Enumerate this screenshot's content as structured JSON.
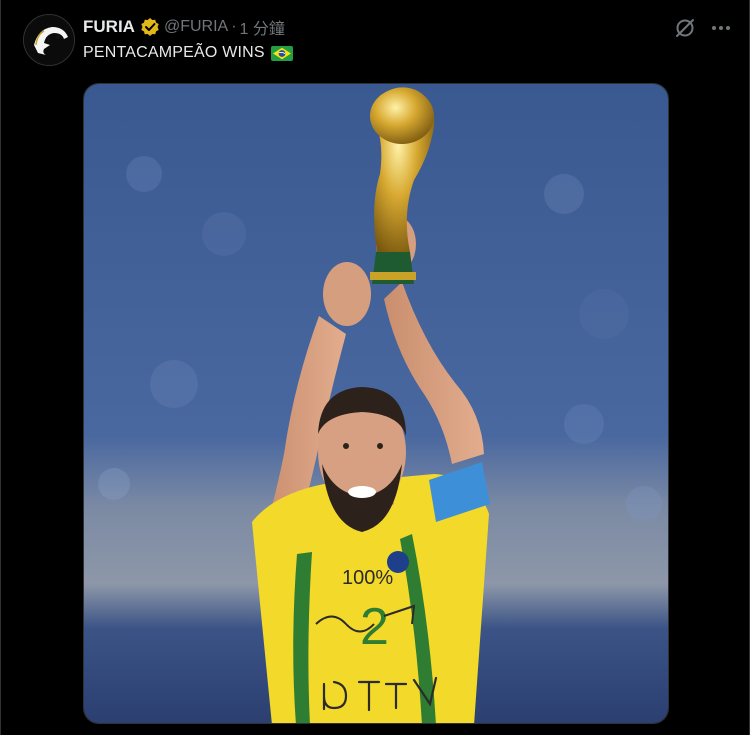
{
  "post": {
    "display_name": "FURIA",
    "handle": "@FURIA",
    "separator": "·",
    "time": "1 分鐘",
    "text": "PENTACAMPEÃO WINS",
    "flag_emoji": "brazil-flag",
    "verified_icon": "gold-verified-badge-icon",
    "avatar_icon": "panther-logo-icon"
  },
  "actions": {
    "grok_icon": "grok-icon",
    "more_icon": "more-icon"
  },
  "media": {
    "description_icon": "photo",
    "jersey_text_top": "100%",
    "jersey_number": "2",
    "colors": {
      "stadium_blue": "#3f5f95",
      "jersey_yellow": "#f2d92a",
      "jersey_green": "#2e7d32",
      "armband_blue": "#3d8fd8",
      "trophy_gold": "#c9a227"
    }
  }
}
